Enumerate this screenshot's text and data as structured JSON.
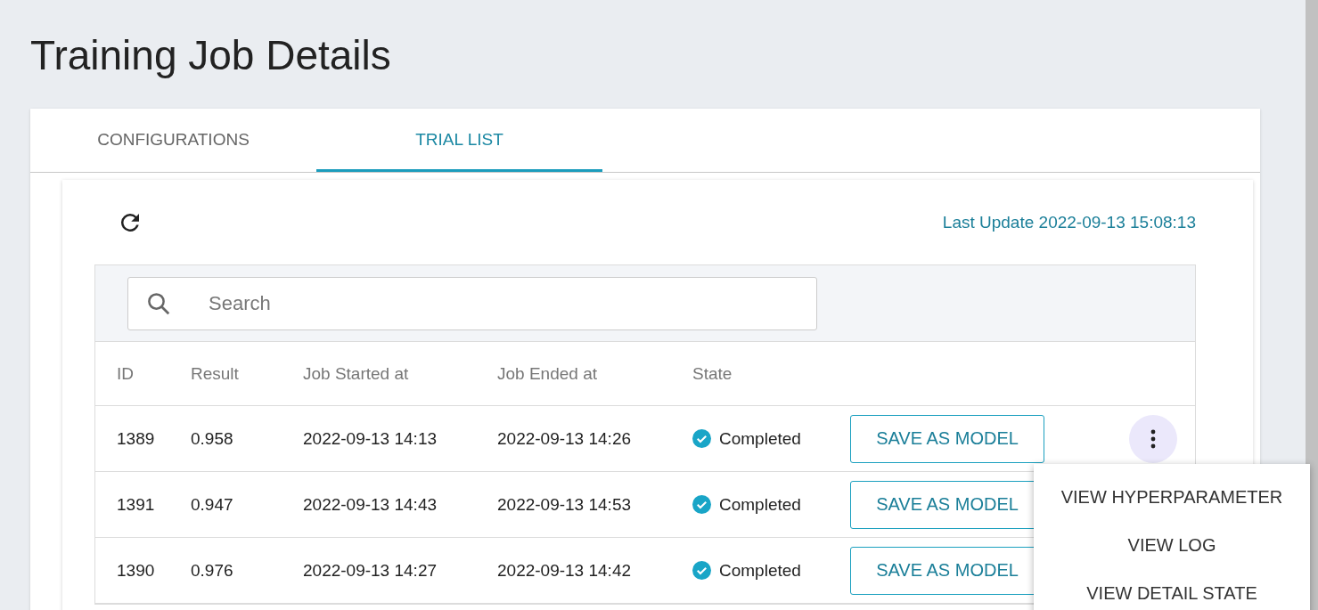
{
  "page": {
    "title": "Training Job Details"
  },
  "tabs": [
    {
      "label": "CONFIGURATIONS",
      "selected": false
    },
    {
      "label": "TRIAL LIST",
      "selected": true
    }
  ],
  "toolbar": {
    "last_update": "Last Update 2022-09-13 15:08:13"
  },
  "search": {
    "placeholder": "Search"
  },
  "table": {
    "columns": [
      "ID",
      "Result",
      "Job Started at",
      "Job Ended at",
      "State"
    ],
    "rows": [
      {
        "id": "1389",
        "result": "0.958",
        "started": "2022-09-13 14:13",
        "ended": "2022-09-13 14:26",
        "state": "Completed",
        "action": "SAVE AS MODEL",
        "menu_open": true
      },
      {
        "id": "1391",
        "result": "0.947",
        "started": "2022-09-13 14:43",
        "ended": "2022-09-13 14:53",
        "state": "Completed",
        "action": "SAVE AS MODEL"
      },
      {
        "id": "1390",
        "result": "0.976",
        "started": "2022-09-13 14:27",
        "ended": "2022-09-13 14:42",
        "state": "Completed",
        "action": "SAVE AS MODEL"
      }
    ]
  },
  "menu": {
    "items": [
      "VIEW HYPERPARAMETER",
      "VIEW LOG",
      "VIEW DETAIL STATE"
    ]
  }
}
